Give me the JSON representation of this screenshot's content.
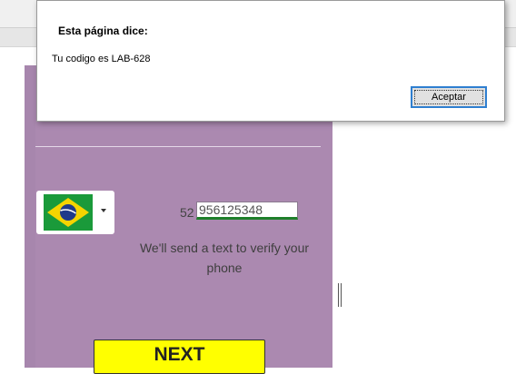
{
  "dialog": {
    "title": "Esta página dice:",
    "message": "Tu codigo es LAB-628",
    "accept_label": "Aceptar"
  },
  "form": {
    "country_prefix": "52",
    "phone_value": "956125348",
    "hint": "We'll send a text to verify your phone",
    "next_label": "NEXT",
    "country_flag_icon": "brazil-flag-icon"
  },
  "colors": {
    "panel_bg": "#ab89b0",
    "next_button": "#ffff00",
    "input_underline": "#1e7f2a",
    "dialog_focus": "#2f7fd0"
  }
}
